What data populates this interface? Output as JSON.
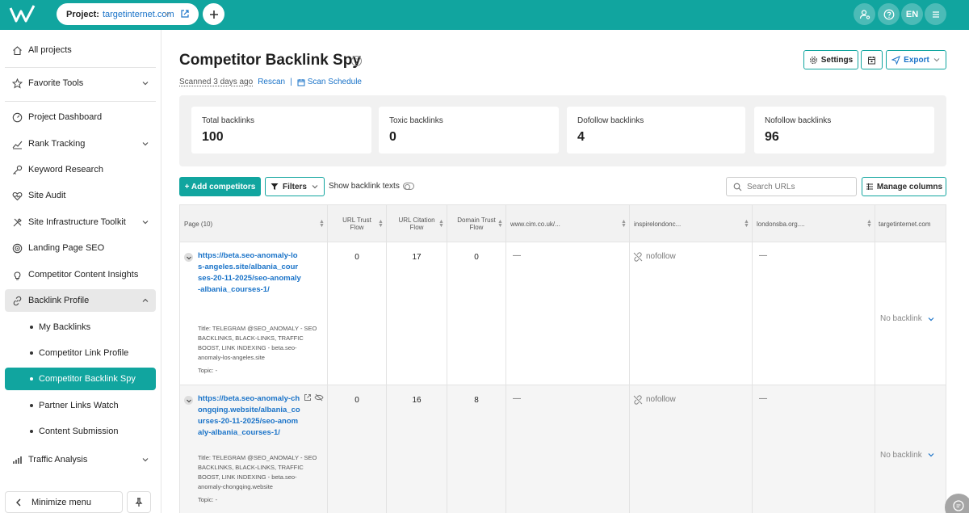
{
  "topbar": {
    "project_label": "Project:",
    "project_value": "targetinternet.com",
    "language": "EN"
  },
  "sidebar": {
    "items": [
      {
        "label": "All projects",
        "icon": "home-icon"
      },
      {
        "label": "Favorite Tools",
        "icon": "star-icon"
      },
      {
        "label": "Project Dashboard",
        "icon": "gauge-icon"
      },
      {
        "label": "Rank Tracking",
        "icon": "trend-icon"
      },
      {
        "label": "Keyword Research",
        "icon": "key-icon"
      },
      {
        "label": "Site Audit",
        "icon": "heart-pulse-icon"
      },
      {
        "label": "Site Infrastructure Toolkit",
        "icon": "tools-icon"
      },
      {
        "label": "Landing Page SEO",
        "icon": "target-icon"
      },
      {
        "label": "Competitor Content Insights",
        "icon": "bulb-icon"
      },
      {
        "label": "Backlink Profile",
        "icon": "link-icon"
      },
      {
        "label": "Traffic Analysis",
        "icon": "bars-icon"
      }
    ],
    "sub_items": [
      {
        "label": "My Backlinks"
      },
      {
        "label": "Competitor Link Profile"
      },
      {
        "label": "Competitor Backlink Spy"
      },
      {
        "label": "Partner Links Watch"
      },
      {
        "label": "Content Submission"
      }
    ],
    "minimize_label": "Minimize menu"
  },
  "header": {
    "title": "Competitor Backlink Spy",
    "scanned": "Scanned 3 days ago",
    "rescan": "Rescan",
    "separator": "|",
    "scan_schedule": "Scan Schedule",
    "settings_label": "Settings",
    "export_label": "Export"
  },
  "stats": [
    {
      "label": "Total backlinks",
      "value": "100"
    },
    {
      "label": "Toxic backlinks",
      "value": "0"
    },
    {
      "label": "Dofollow backlinks",
      "value": "4"
    },
    {
      "label": "Nofollow backlinks",
      "value": "96"
    }
  ],
  "toolbar": {
    "add_competitors": "+ Add competitors",
    "filters": "Filters",
    "show_backlink_texts": "Show backlink texts",
    "search_placeholder": "Search URLs",
    "manage_columns": "Manage columns"
  },
  "table": {
    "columns": [
      "Page (10)",
      "URL Trust Flow",
      "URL Citation Flow",
      "Domain Trust Flow",
      "www.cim.co.uk/...",
      "inspirelondonc...",
      "londonsba.org....",
      "targetinternet.com"
    ],
    "rows": [
      {
        "url": "https://beta.seo-anomaly-los-angeles.site/albania_courses-20-11-2025/seo-anomaly-albania_courses-1/",
        "title": "Title: TELEGRAM @SEO_ANOMALY - SEO BACKLINKS, BLACK-LINKS, TRAFFIC BOOST, LINK INDEXING - beta.seo-anomaly-los-angeles.site",
        "topic": "Topic: -",
        "url_tf": "0",
        "url_cf": "17",
        "domain_tf": "0",
        "c1": "—",
        "c2": "nofollow",
        "c3": "—",
        "c4": "No backlink"
      },
      {
        "url": "https://beta.seo-anomaly-chongqing.website/albania_courses-20-11-2025/seo-anomaly-albania_courses-1/",
        "title": "Title: TELEGRAM @SEO_ANOMALY - SEO BACKLINKS, BLACK-LINKS, TRAFFIC BOOST, LINK INDEXING - beta.seo-anomaly-chongqing.website",
        "topic": "Topic: -",
        "url_tf": "0",
        "url_cf": "16",
        "domain_tf": "8",
        "c1": "—",
        "c2": "nofollow",
        "c3": "—",
        "c4": "No backlink"
      }
    ]
  },
  "colors": {
    "brand": "#11a59f",
    "link": "#1a73c8"
  }
}
